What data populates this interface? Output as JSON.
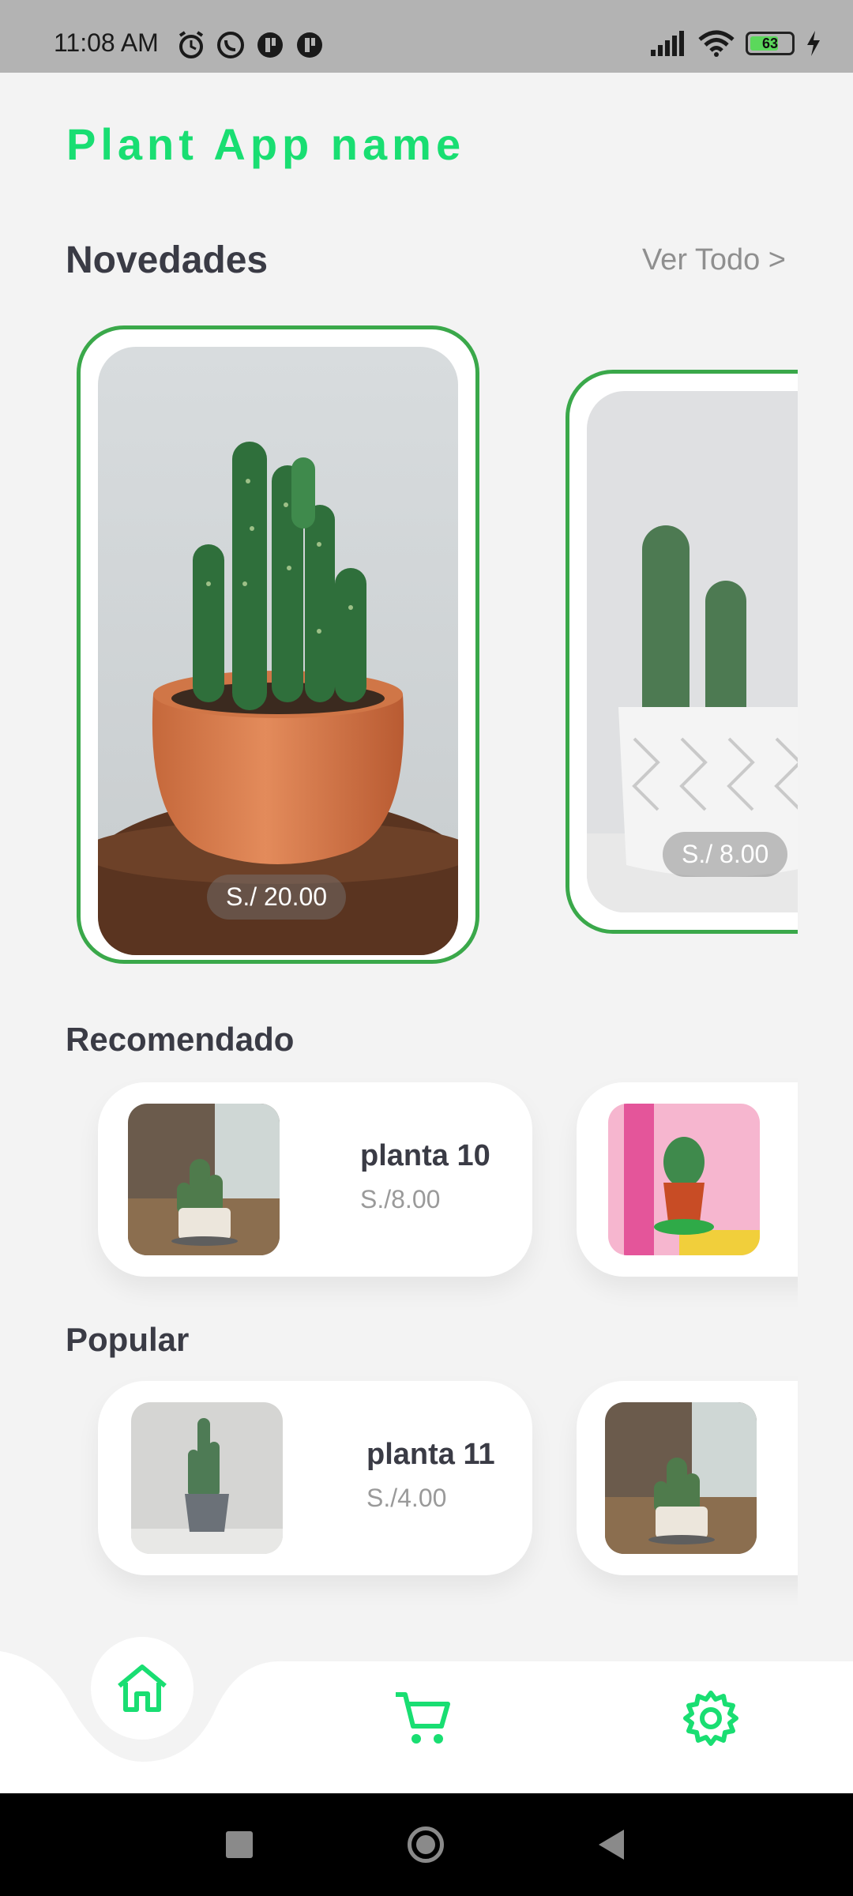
{
  "status_bar": {
    "time": "11:08 AM",
    "battery": "63",
    "left_icons": [
      "alarm-icon",
      "whatsapp-icon",
      "app-icon",
      "app-icon"
    ],
    "right_icons": [
      "signal-icon",
      "wifi-icon",
      "battery-icon",
      "charging-icon"
    ]
  },
  "app": {
    "title": "Plant App name",
    "accent": "#19de72",
    "card_border": "#3aa84a"
  },
  "novedades": {
    "title": "Novedades",
    "see_all": "Ver Todo >",
    "items": [
      {
        "price": "S./ 20.00"
      },
      {
        "price": "S./ 8.00"
      }
    ]
  },
  "recomendado": {
    "title": "Recomendado",
    "items": [
      {
        "name": "planta 10",
        "price": "S./8.00"
      },
      {
        "name": "",
        "price": ""
      }
    ]
  },
  "popular": {
    "title": "Popular",
    "items": [
      {
        "name": "planta 11",
        "price": "S./4.00"
      },
      {
        "name": "",
        "price": ""
      }
    ]
  },
  "bottom_nav": {
    "items": [
      "home-icon",
      "cart-icon",
      "settings-icon"
    ]
  },
  "system_nav": [
    "recents-icon",
    "home-circle-icon",
    "back-icon"
  ]
}
